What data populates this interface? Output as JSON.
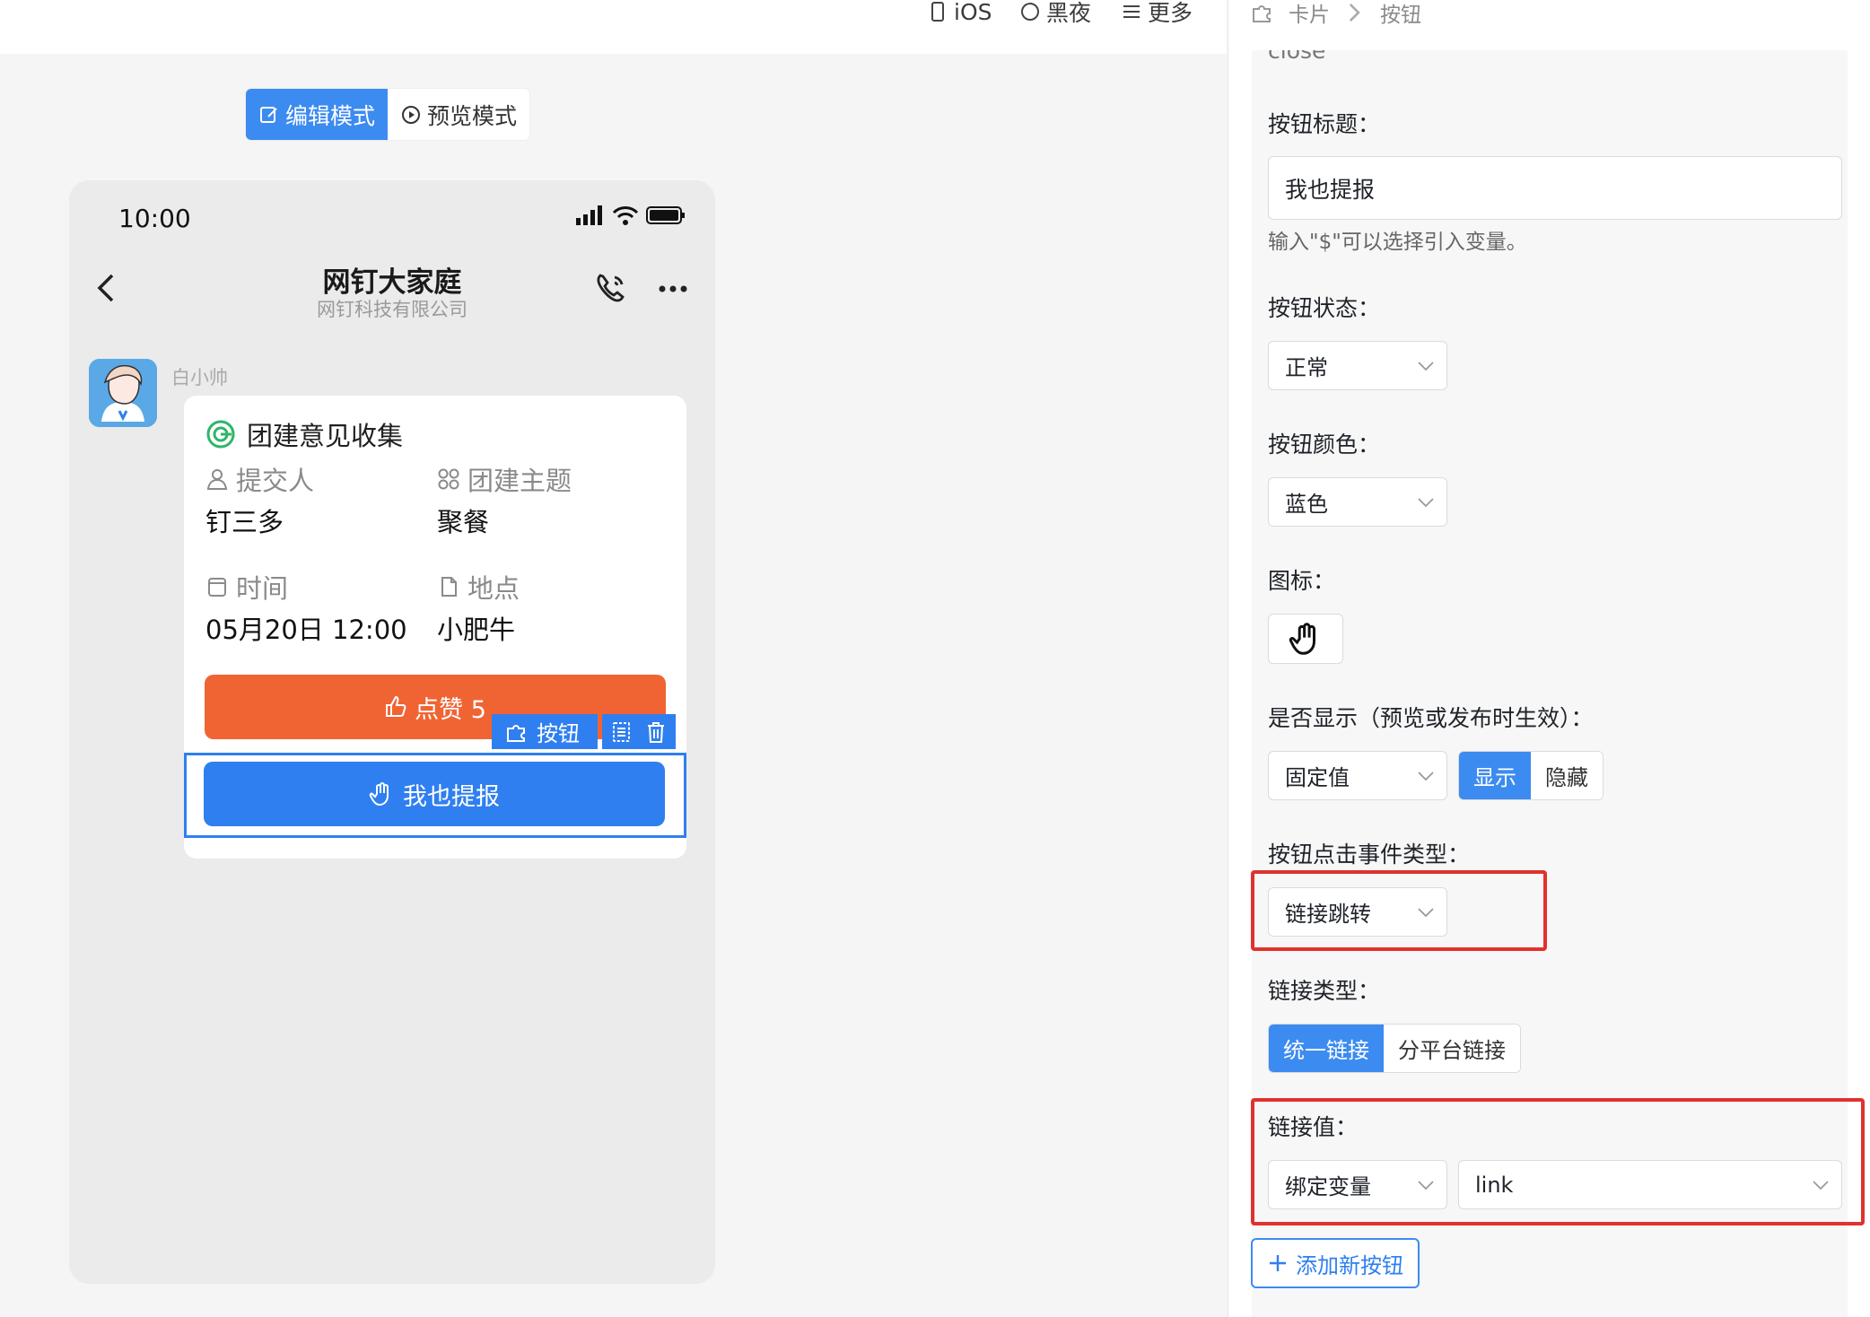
{
  "topbar": {
    "ios": "iOS",
    "dark": "黑夜",
    "more": "更多"
  },
  "modes": {
    "edit": "编辑模式",
    "preview": "预览模式"
  },
  "phone": {
    "time": "10:00",
    "title": "网钉大家庭",
    "subtitle": "网钉科技有限公司",
    "sender": "白小帅",
    "card": {
      "title": "团建意见收集",
      "fields": [
        {
          "label": "提交人",
          "value": "钉三多",
          "icon": "person-icon"
        },
        {
          "label": "团建主题",
          "value": "聚餐",
          "icon": "grid-icon"
        },
        {
          "label": "时间",
          "value": "05月20日 12:00",
          "icon": "calendar-icon"
        },
        {
          "label": "地点",
          "value": "小肥牛",
          "icon": "document-icon"
        }
      ],
      "like_button": "点赞 5",
      "report_button": "我也提报",
      "selection_tag": "按钮"
    }
  },
  "panel": {
    "breadcrumb": {
      "card": "卡片",
      "current": "按钮"
    },
    "cut_text": "close",
    "title_label": "按钮标题：",
    "title_value": "我也提报",
    "title_help": "输入\"$\"可以选择引入变量。",
    "state_label": "按钮状态：",
    "state_value": "正常",
    "color_label": "按钮颜色：",
    "color_value": "蓝色",
    "icon_label": "图标：",
    "icon_name": "hand-icon",
    "display_label": "是否显示（预览或发布时生效）：",
    "display_mode": "固定值",
    "display_options": [
      "显示",
      "隐藏"
    ],
    "event_label": "按钮点击事件类型：",
    "event_value": "链接跳转",
    "link_type_label": "链接类型：",
    "link_type_options": [
      "统一链接",
      "分平台链接"
    ],
    "link_value_label": "链接值：",
    "link_value_mode": "绑定变量",
    "link_value_var": "link",
    "add_button": "添加新按钮"
  },
  "colors": {
    "primary": "#3c8bf0",
    "like": "#f06434",
    "highlight": "#e0322d"
  }
}
